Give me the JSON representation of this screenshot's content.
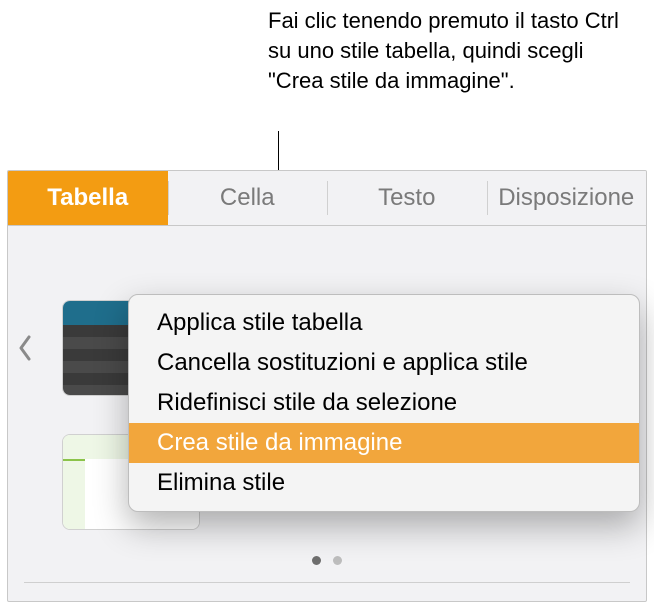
{
  "callout": {
    "text": "Fai clic tenendo premuto il tasto Ctrl su uno stile tabella, quindi scegli \"Crea stile da immagine\"."
  },
  "tabs": {
    "items": [
      {
        "label": "Tabella",
        "active": true
      },
      {
        "label": "Cella",
        "active": false
      },
      {
        "label": "Testo",
        "active": false
      },
      {
        "label": "Disposizione",
        "active": false
      }
    ]
  },
  "styles": {
    "thumb1_name": "table-style-dark",
    "thumb2_name": "table-style-teal",
    "thumb3_name": "table-style-orange",
    "thumb4_name": "table-style-green",
    "colors": {
      "accent_orange": "#f39c12",
      "teal": "#009e8e",
      "red_orange": "#e2582c",
      "green": "#8bc34a"
    },
    "page_count": 2,
    "page_index": 0
  },
  "context_menu": {
    "items": [
      {
        "label": "Applica stile tabella"
      },
      {
        "label": "Cancella sostituzioni e applica stile"
      },
      {
        "label": "Ridefinisci stile da selezione"
      },
      {
        "label": "Crea stile da immagine"
      },
      {
        "label": "Elimina stile"
      }
    ],
    "highlighted_index": 3
  }
}
